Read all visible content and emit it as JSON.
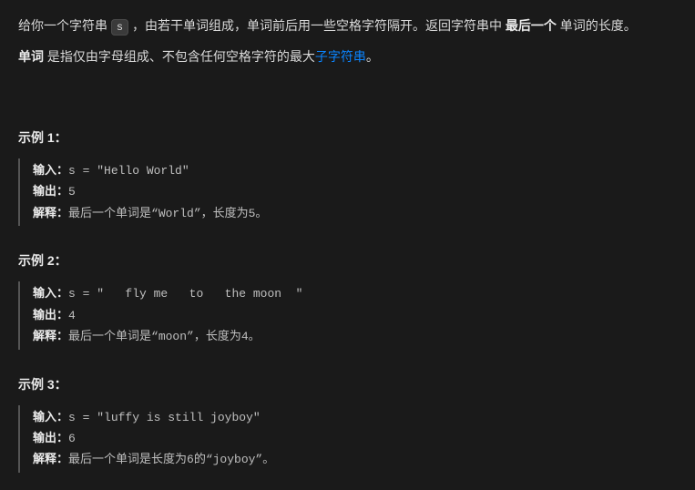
{
  "intro": {
    "p1_a": "给你一个字符串 ",
    "p1_code": "s",
    "p1_b": " ，由若干单词组成，单词前后用一些空格字符隔开。返回字符串中 ",
    "p1_bold": "最后一个",
    "p1_c": " 单词的长度。",
    "p2_bold": "单词",
    "p2_a": " 是指仅由字母组成、不包含任何空格字符的最大",
    "p2_link": "子字符串",
    "p2_b": "。"
  },
  "examples": [
    {
      "title": "示例 1：",
      "input_label": "输入：",
      "input_value": "s = \"Hello World\"",
      "output_label": "输出：",
      "output_value": "5",
      "explain_label": "解释：",
      "explain_value": "最后一个单词是“World”，长度为5。"
    },
    {
      "title": "示例 2：",
      "input_label": "输入：",
      "input_value": "s = \"   fly me   to   the moon  \"",
      "output_label": "输出：",
      "output_value": "4",
      "explain_label": "解释：",
      "explain_value": "最后一个单词是“moon”，长度为4。"
    },
    {
      "title": "示例 3：",
      "input_label": "输入：",
      "input_value": "s = \"luffy is still joyboy\"",
      "output_label": "输出：",
      "output_value": "6",
      "explain_label": "解释：",
      "explain_value": "最后一个单词是长度为6的“joyboy”。"
    }
  ]
}
